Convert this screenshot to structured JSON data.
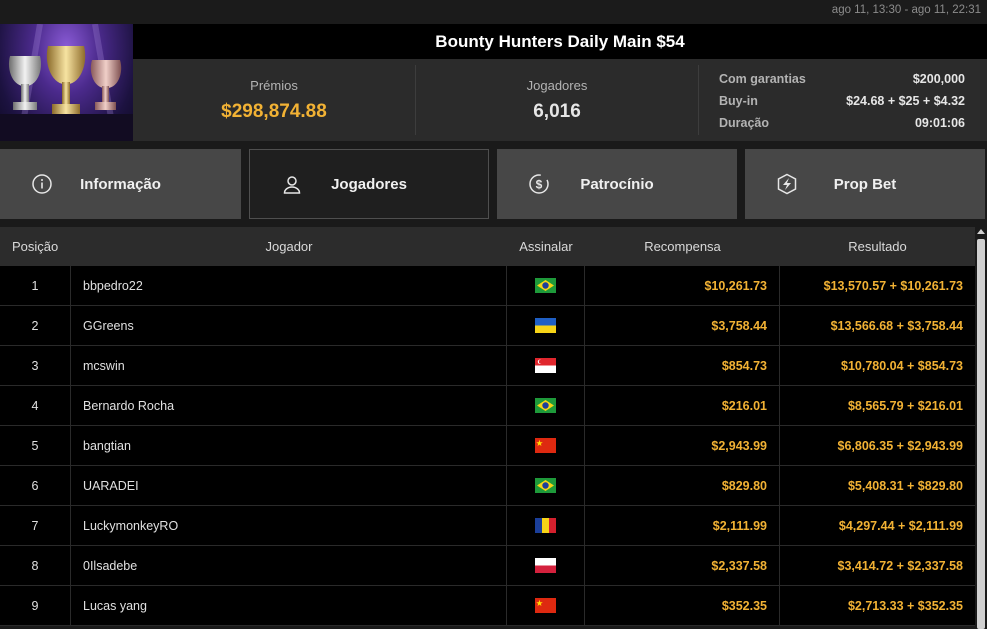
{
  "topbar": {
    "date_range": "ago 11, 13:30 - ago 11, 22:31"
  },
  "tournament": {
    "title": "Bounty Hunters Daily Main $54",
    "prizes_label": "Prémios",
    "prizes_value": "$298,874.88",
    "players_label": "Jogadores",
    "players_value": "6,016",
    "details": [
      {
        "label": "Com garantias",
        "value": "$200,000"
      },
      {
        "label": "Buy-in",
        "value": "$24.68 + $25 + $4.32"
      },
      {
        "label": "Duração",
        "value": "09:01:06"
      }
    ]
  },
  "tabs": [
    {
      "label": "Informação",
      "icon": "info-icon"
    },
    {
      "label": "Jogadores",
      "icon": "user-icon",
      "active": true
    },
    {
      "label": "Patrocínio",
      "icon": "coin-icon"
    },
    {
      "label": "Prop Bet",
      "icon": "bolt-icon"
    }
  ],
  "table": {
    "headers": {
      "position": "Posição",
      "player": "Jogador",
      "flag": "Assinalar",
      "reward": "Recompensa",
      "result": "Resultado"
    },
    "rows": [
      {
        "pos": "1",
        "name": "bbpedro22",
        "flag": "brazil",
        "reward": "$10,261.73",
        "result": "$13,570.57 + $10,261.73"
      },
      {
        "pos": "2",
        "name": "GGreens",
        "flag": "ukraine",
        "reward": "$3,758.44",
        "result": "$13,566.68 + $3,758.44"
      },
      {
        "pos": "3",
        "name": "mcswin",
        "flag": "singapore",
        "reward": "$854.73",
        "result": "$10,780.04 + $854.73"
      },
      {
        "pos": "4",
        "name": "Bernardo Rocha",
        "flag": "brazil",
        "reward": "$216.01",
        "result": "$8,565.79 + $216.01"
      },
      {
        "pos": "5",
        "name": "bangtian",
        "flag": "china",
        "reward": "$2,943.99",
        "result": "$6,806.35 + $2,943.99"
      },
      {
        "pos": "6",
        "name": "UARADEI",
        "flag": "brazil",
        "reward": "$829.80",
        "result": "$5,408.31 + $829.80"
      },
      {
        "pos": "7",
        "name": "LuckymonkeyRO",
        "flag": "romania",
        "reward": "$2,111.99",
        "result": "$4,297.44 + $2,111.99"
      },
      {
        "pos": "8",
        "name": "0Ilsadebe",
        "flag": "poland",
        "reward": "$2,337.58",
        "result": "$3,414.72 + $2,337.58"
      },
      {
        "pos": "9",
        "name": "Lucas yang",
        "flag": "china",
        "reward": "$352.35",
        "result": "$2,713.33 + $352.35"
      }
    ]
  },
  "colors": {
    "accent_gold": "#f2b234",
    "tab_bg": "#474747",
    "active_tab_bg": "#1f1f1f"
  }
}
